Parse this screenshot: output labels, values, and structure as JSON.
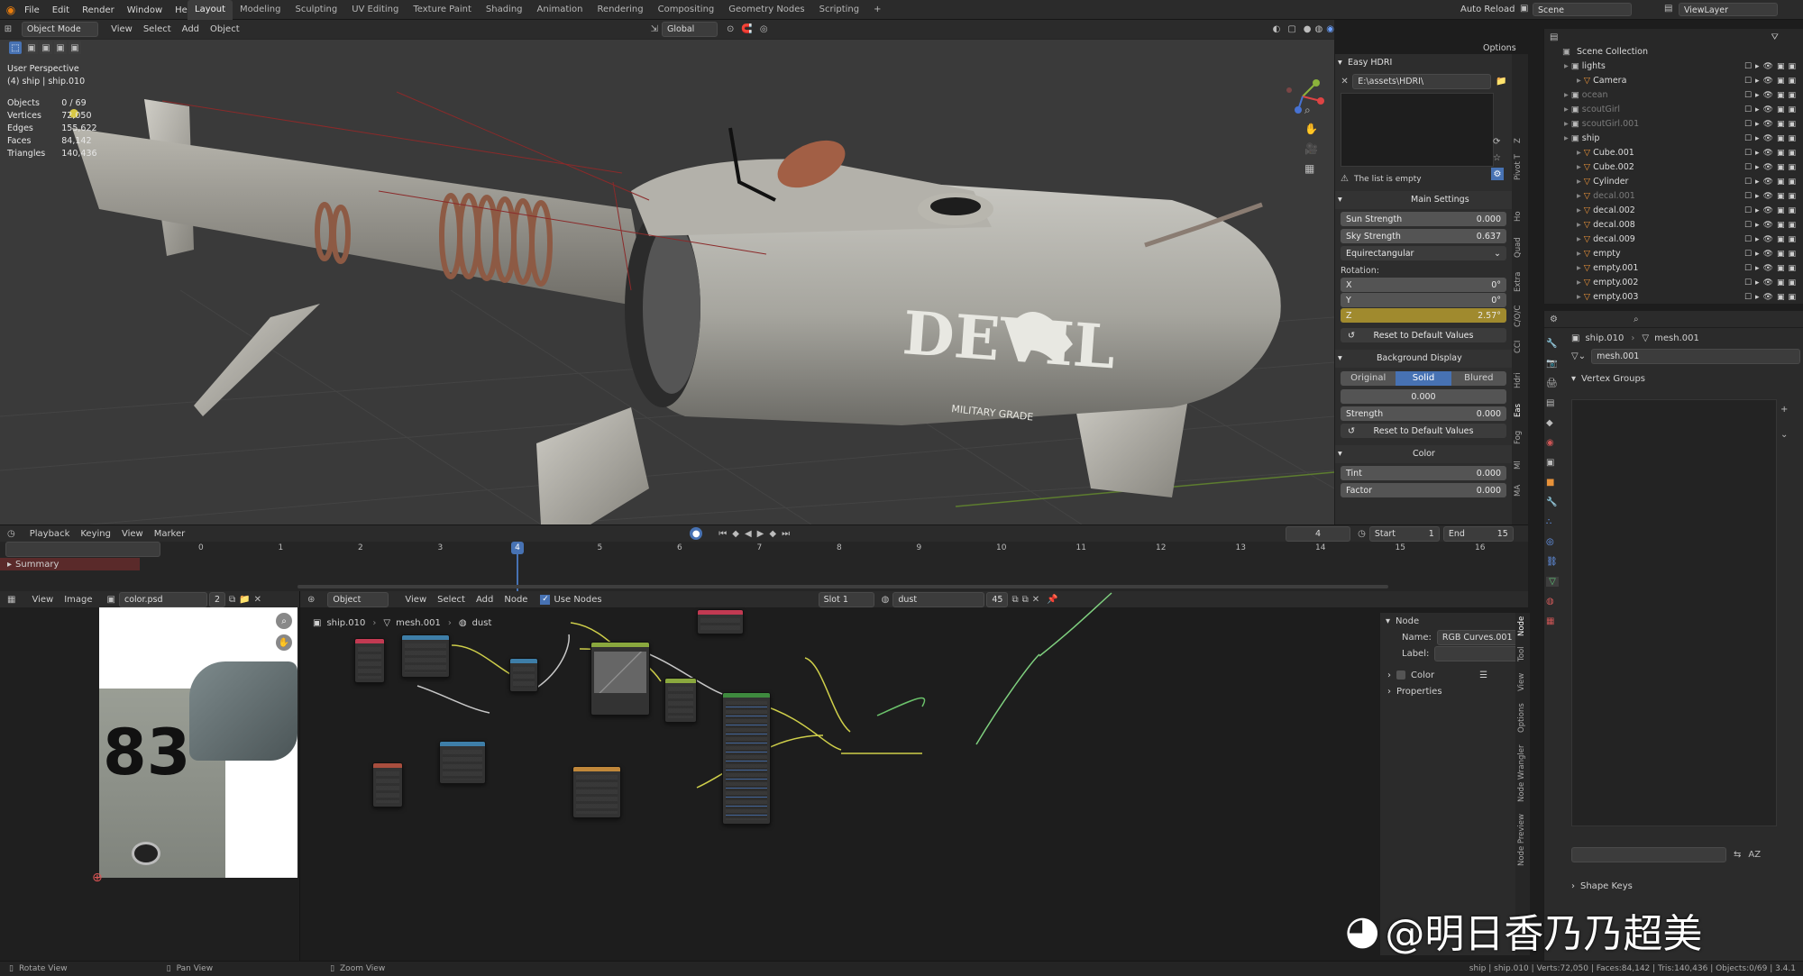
{
  "topbar": {
    "menu": [
      "File",
      "Edit",
      "Render",
      "Window",
      "Help"
    ],
    "workspaces": [
      "Layout",
      "Modeling",
      "Sculpting",
      "UV Editing",
      "Texture Paint",
      "Shading",
      "Animation",
      "Rendering",
      "Compositing",
      "Geometry Nodes",
      "Scripting"
    ],
    "active_workspace": "Layout",
    "auto_reload": "Auto Reload",
    "scene": "Scene",
    "viewlayer": "ViewLayer"
  },
  "viewport_header": {
    "mode": "Object Mode",
    "menus": [
      "View",
      "Select",
      "Add",
      "Object"
    ],
    "orientation": "Global",
    "options": "Options"
  },
  "hud": {
    "perspective": "User Perspective",
    "object": "(4) ship | ship.010"
  },
  "stats": [
    {
      "label": "Objects",
      "value": "0 / 69"
    },
    {
      "label": "Vertices",
      "value": "72,050"
    },
    {
      "label": "Edges",
      "value": "155,622"
    },
    {
      "label": "Faces",
      "value": "84,142"
    },
    {
      "label": "Triangles",
      "value": "140,436"
    }
  ],
  "ship_decal": {
    "text": "DEVIL",
    "sub": "MILITARY GRADE"
  },
  "npanel": {
    "addon": "Easy HDRI",
    "path": "E:\\assets\\HDRI\\",
    "empty_msg": "The list is empty",
    "main_settings": "Main Settings",
    "sun_strength_label": "Sun Strength",
    "sun_strength": "0.000",
    "sky_strength_label": "Sky Strength",
    "sky_strength": "0.637",
    "projection": "Equirectangular",
    "rotation_label": "Rotation:",
    "rot_x_label": "X",
    "rot_x": "0°",
    "rot_y_label": "Y",
    "rot_y": "0°",
    "rot_z_label": "Z",
    "rot_z": "2.57°",
    "reset": "Reset to Default Values",
    "bg_display": "Background Display",
    "bg_modes": [
      "Original",
      "Solid",
      "Blured"
    ],
    "bg_value": "0.000",
    "strength_label": "Strength",
    "strength": "0.000",
    "color_section": "Color",
    "tint_label": "Tint",
    "tint": "0.000",
    "factor_label": "Factor",
    "factor": "0.000"
  },
  "side_tabs": [
    "Z",
    "Pivot T",
    "Ho",
    "Quad",
    "Extra",
    "C/O/C",
    "CCI",
    "Hdri",
    "Eas",
    "Fog",
    "Ml",
    "MA"
  ],
  "outliner": {
    "title": "Scene Collection",
    "rows": [
      {
        "name": "lights",
        "indent": 1,
        "dim": false
      },
      {
        "name": "Camera",
        "indent": 2,
        "dim": false
      },
      {
        "name": "ocean",
        "indent": 1,
        "dim": true
      },
      {
        "name": "scoutGirl",
        "indent": 1,
        "dim": true
      },
      {
        "name": "scoutGirl.001",
        "indent": 1,
        "dim": true
      },
      {
        "name": "ship",
        "indent": 1,
        "dim": false
      },
      {
        "name": "Cube.001",
        "indent": 2,
        "dim": false
      },
      {
        "name": "Cube.002",
        "indent": 2,
        "dim": false
      },
      {
        "name": "Cylinder",
        "indent": 2,
        "dim": false
      },
      {
        "name": "decal.001",
        "indent": 2,
        "dim": true
      },
      {
        "name": "decal.002",
        "indent": 2,
        "dim": false
      },
      {
        "name": "decal.008",
        "indent": 2,
        "dim": false
      },
      {
        "name": "decal.009",
        "indent": 2,
        "dim": false
      },
      {
        "name": "empty",
        "indent": 2,
        "dim": false
      },
      {
        "name": "empty.001",
        "indent": 2,
        "dim": false
      },
      {
        "name": "empty.002",
        "indent": 2,
        "dim": false
      },
      {
        "name": "empty.003",
        "indent": 2,
        "dim": false
      }
    ]
  },
  "properties": {
    "breadcrumb_obj": "ship.010",
    "breadcrumb_mesh": "mesh.001",
    "mesh_name": "mesh.001",
    "vertex_groups": "Vertex Groups",
    "shape_keys": "Shape Keys"
  },
  "timeline": {
    "menus": [
      "Playback",
      "Keying",
      "View",
      "Marker"
    ],
    "current_frame": "4",
    "start_label": "Start",
    "start": "1",
    "end_label": "End",
    "end": "15",
    "summary": "Summary",
    "ticks": [
      0,
      1,
      2,
      3,
      4,
      5,
      6,
      7,
      8,
      9,
      10,
      11,
      12,
      13,
      14,
      15,
      16
    ]
  },
  "image_editor": {
    "menus": [
      "View",
      "Image"
    ],
    "image_name": "color.psd",
    "users": "2",
    "big_number": "83"
  },
  "node_editor": {
    "object": "Object",
    "menus": [
      "View",
      "Select",
      "Add",
      "Node"
    ],
    "use_nodes": "Use Nodes",
    "slot": "Slot 1",
    "material": "dust",
    "mat_users": "45",
    "breadcrumb": [
      "ship.010",
      "mesh.001",
      "dust"
    ],
    "node_panel": {
      "title": "Node",
      "name_label": "Name:",
      "name": "RGB Curves.001",
      "label_label": "Label:",
      "color": "Color",
      "properties": "Properties"
    },
    "side_tabs": [
      "Node",
      "Tool",
      "View",
      "Options",
      "Node Wrangler",
      "Node Preview"
    ]
  },
  "status": {
    "rotate": "Rotate View",
    "pan": "Pan View",
    "zoom": "Zoom View",
    "info": "ship | ship.010 | Verts:72,050 | Faces:84,142 | Tris:140,436 | Objects:0/69 | 3.4.1"
  },
  "watermark": "@明日香乃乃超美",
  "colors": {
    "accent_blue": "#4772b3",
    "rotation_z_highlight": "#a08a2e"
  }
}
